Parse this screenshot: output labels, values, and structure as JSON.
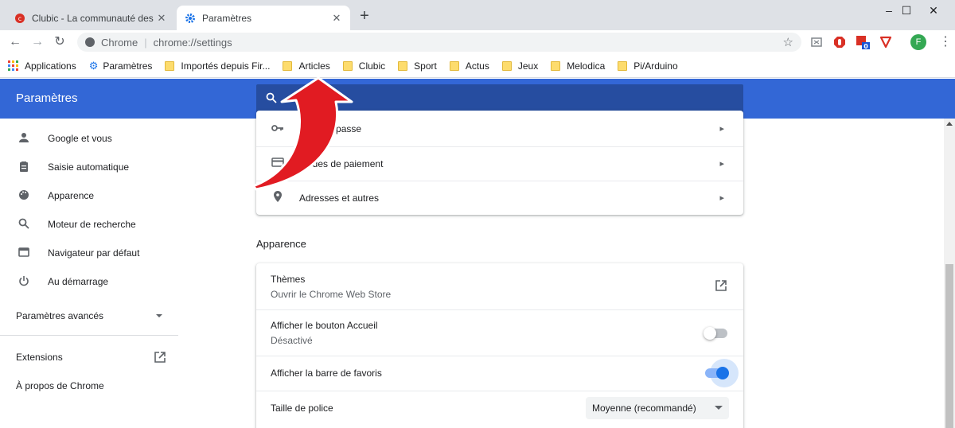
{
  "tabs": [
    {
      "title": "Clubic - La communauté des passionnés",
      "active": false,
      "icon": "clubic-icon"
    },
    {
      "title": "Paramètres",
      "active": true,
      "icon": "settings-gear-icon"
    }
  ],
  "toolbar": {
    "omnibox_label": "Chrome",
    "url": "chrome://settings",
    "avatar_letter": "F",
    "badge_count": "0"
  },
  "bookmarks": [
    {
      "label": "Applications",
      "type": "apps"
    },
    {
      "label": "Paramètres",
      "type": "settings"
    },
    {
      "label": "Importés depuis Fir...",
      "type": "folder"
    },
    {
      "label": "Articles",
      "type": "folder"
    },
    {
      "label": "Clubic",
      "type": "folder"
    },
    {
      "label": "Sport",
      "type": "folder"
    },
    {
      "label": "Actus",
      "type": "folder"
    },
    {
      "label": "Jeux",
      "type": "folder"
    },
    {
      "label": "Melodica",
      "type": "folder"
    },
    {
      "label": "Pi/Arduino",
      "type": "folder"
    }
  ],
  "header": {
    "title": "Paramètres"
  },
  "sidebar": {
    "items": [
      {
        "label": "Google et vous",
        "icon": "person-icon"
      },
      {
        "label": "Saisie automatique",
        "icon": "clipboard-icon"
      },
      {
        "label": "Apparence",
        "icon": "palette-icon"
      },
      {
        "label": "Moteur de recherche",
        "icon": "search-icon"
      },
      {
        "label": "Navigateur par défaut",
        "icon": "browser-icon"
      },
      {
        "label": "Au démarrage",
        "icon": "power-icon"
      }
    ],
    "advanced": "Paramètres avancés",
    "extensions": "Extensions",
    "about": "À propos de Chrome"
  },
  "autofill": {
    "rows": [
      {
        "label": "Mots de passe",
        "icon": "key-icon"
      },
      {
        "label": "Modes de paiement",
        "icon": "credit-card-icon"
      },
      {
        "label": "Adresses et autres",
        "icon": "location-pin-icon"
      }
    ]
  },
  "appearance": {
    "section_title": "Apparence",
    "themes_label": "Thèmes",
    "themes_sub": "Ouvrir le Chrome Web Store",
    "home_label": "Afficher le bouton Accueil",
    "home_sub": "Désactivé",
    "home_enabled": false,
    "bookmarks_label": "Afficher la barre de favoris",
    "bookmarks_enabled": true,
    "font_label": "Taille de police",
    "font_value": "Moyenne (recommandé)"
  },
  "colors": {
    "header_blue": "#3367d6",
    "search_blue": "#264da0",
    "toggle_on": "#1a73e8",
    "arrow_red": "#e11b22"
  }
}
